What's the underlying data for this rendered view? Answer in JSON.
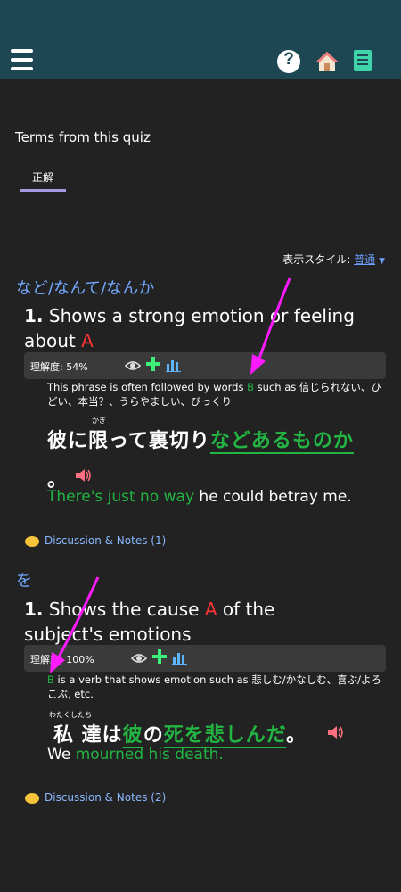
{
  "nav": {
    "menu_icon": "hamburger-menu-icon",
    "help_icon": "help-icon",
    "home_icon": "home-icon",
    "book_icon": "notebook-icon"
  },
  "header": {
    "title": "Terms from this quiz"
  },
  "tabs": [
    {
      "label": "正解",
      "active": true
    }
  ],
  "display_style": {
    "label": "表示スタイル:",
    "value": "普通"
  },
  "items": [
    {
      "grammar": "など/なんて/なんか",
      "number": "1.",
      "meaning": "Shows a strong emotion or feeling about",
      "meaning_marker": "A",
      "understanding": "理解度: 54%",
      "understanding_pct": 54,
      "note_pre": "This phrase is often followed by words",
      "note_marker": "B",
      "note_post": "such as 信じられない、ひどい、本当？、うらやましい、びっくり",
      "jp_plain": "彼に限って裏切り",
      "jp_furigana": "かぎ",
      "jp_highlight": "などあるものか",
      "jp_end": "。",
      "en_highlight": "There's just no way",
      "en_rest": "he could betray me.",
      "discussion": "Discussion & Notes (1)"
    },
    {
      "grammar": "を",
      "number": "1.",
      "meaning_pre": "Shows the cause",
      "meaning_marker": "A",
      "meaning_post": "of the subject's emotions",
      "understanding": "理解度: 100%",
      "understanding_pct": 100,
      "note_marker": "B",
      "note_post": "is a verb that shows emotion such as 悲しむ/かなしむ、喜ぶ/よろこぶ, etc.",
      "jp_furigana": "わたくしたち",
      "jp_1": "私 達は",
      "jp_2": "彼",
      "jp_3": "の",
      "jp_4": "死を悲しんだ",
      "jp_5": "。",
      "en_plain": "We",
      "en_highlight": "mourned his death.",
      "discussion": "Discussion & Notes (2)"
    }
  ],
  "colors": {
    "header_bg": "#1d4853",
    "page_bg": "#222222",
    "accent_green": "#22b543",
    "accent_red": "#ff3535",
    "link_blue": "#72a9ff",
    "annotation_magenta": "#ff1aff"
  }
}
